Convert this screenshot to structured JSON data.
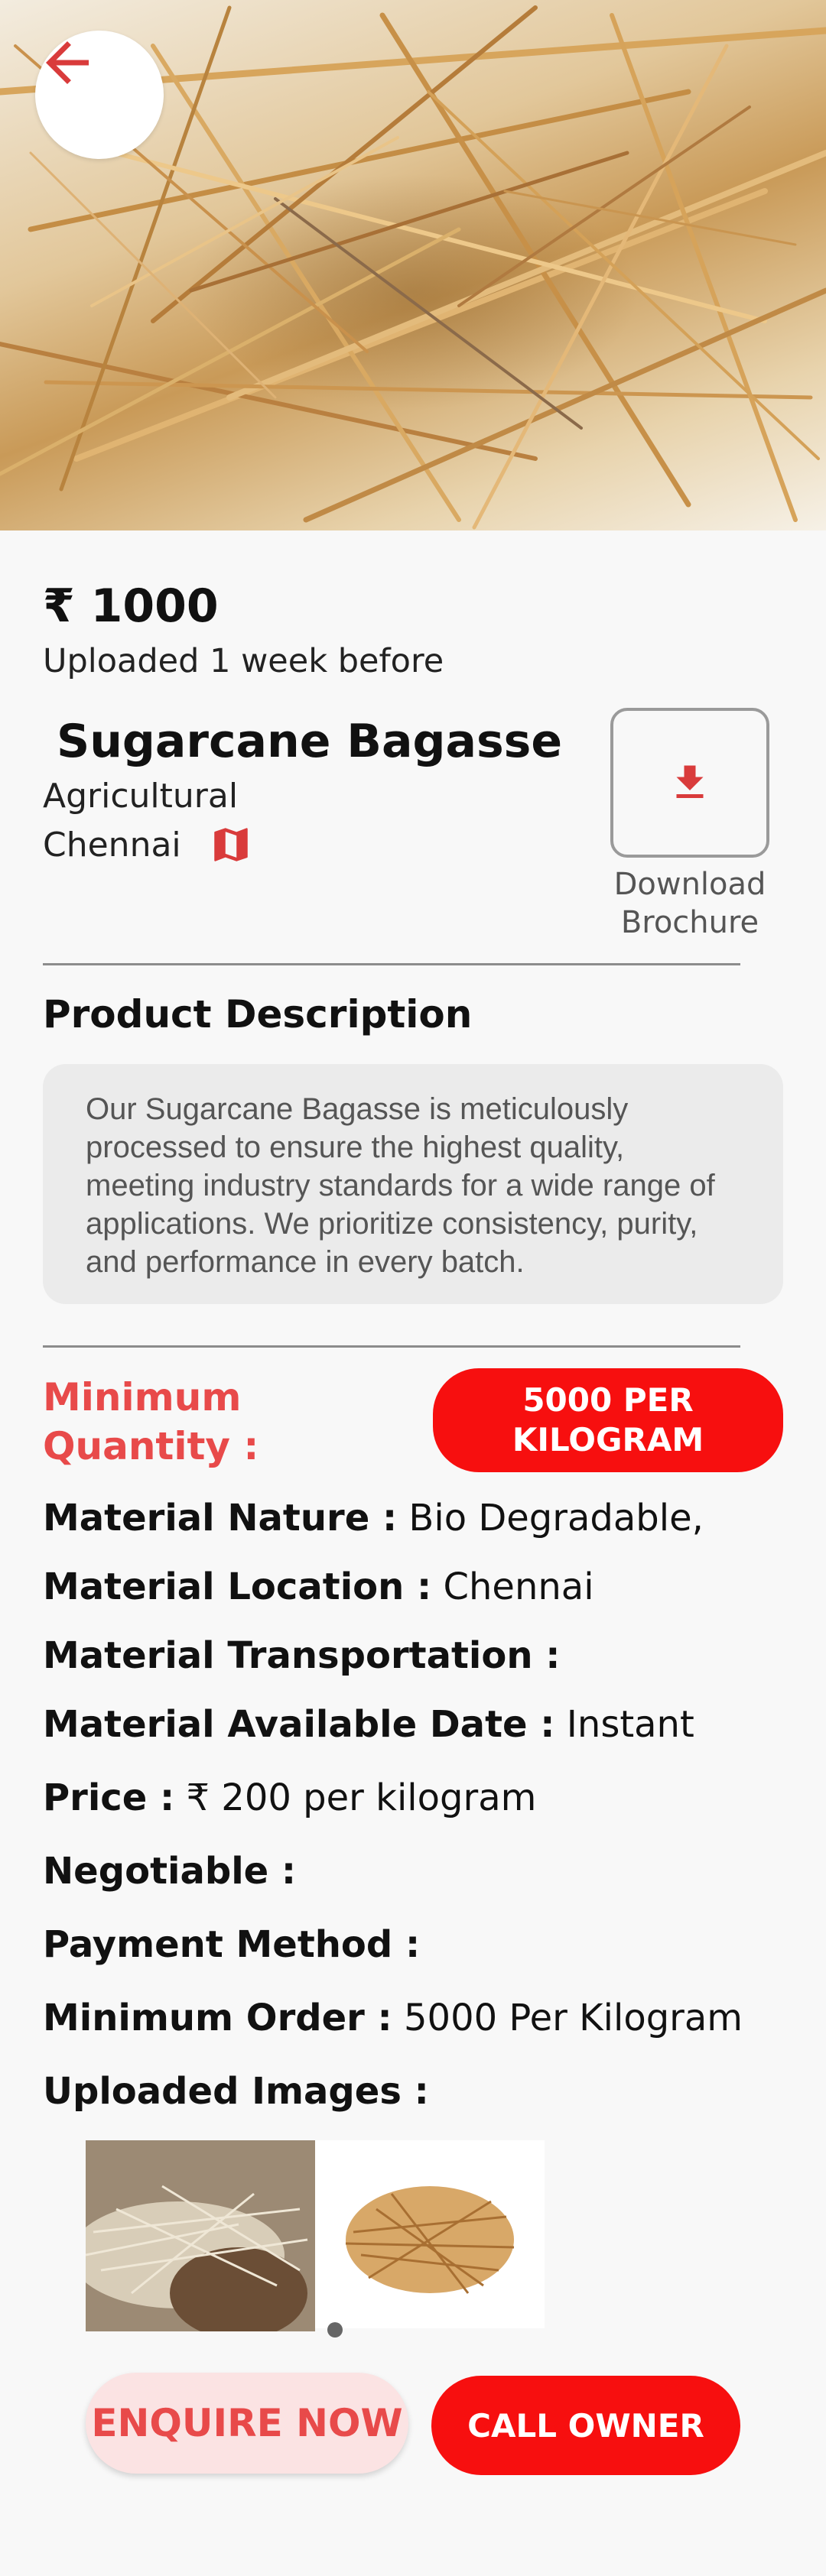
{
  "hero": {
    "image": "sugarcane-bagasse-photo"
  },
  "listing": {
    "price": "₹ 1000",
    "uploaded": "Uploaded 1 week before",
    "title": "Sugarcane Bagasse",
    "category": "Agricultural",
    "location": "Chennai",
    "download_label": "Download Brochure"
  },
  "description": {
    "heading": "Product Description",
    "text": "Our Sugarcane Bagasse is meticulously processed to ensure the highest quality, meeting industry standards for a wide range of applications. We prioritize consistency, purity, and performance in every batch."
  },
  "minimum_quantity": {
    "label": "Minimum Quantity :",
    "value": "5000 PER KILOGRAM"
  },
  "specs": [
    {
      "label": "Material Nature :",
      "value": "Bio Degradable,"
    },
    {
      "label": "Material Location :",
      "value": "Chennai"
    },
    {
      "label": "Material Transportation :",
      "value": ""
    },
    {
      "label": "Material Available Date :",
      "value": "Instant"
    },
    {
      "label": "Price :",
      "value": "₹ 200 per kilogram"
    },
    {
      "label": "Negotiable :",
      "value": ""
    },
    {
      "label": "Payment Method :",
      "value": ""
    },
    {
      "label": "Minimum Order :",
      "value": "5000 Per Kilogram"
    },
    {
      "label": "Uploaded Images :",
      "value": ""
    }
  ],
  "actions": {
    "enquire": "ENQUIRE NOW",
    "call": "CALL OWNER"
  },
  "colors": {
    "accent_red": "#f70f0f",
    "label_red": "#e84a4a",
    "enquire_bg": "#fbe3e3"
  },
  "icons": [
    "arrow-left-icon",
    "download-icon",
    "map-icon"
  ]
}
